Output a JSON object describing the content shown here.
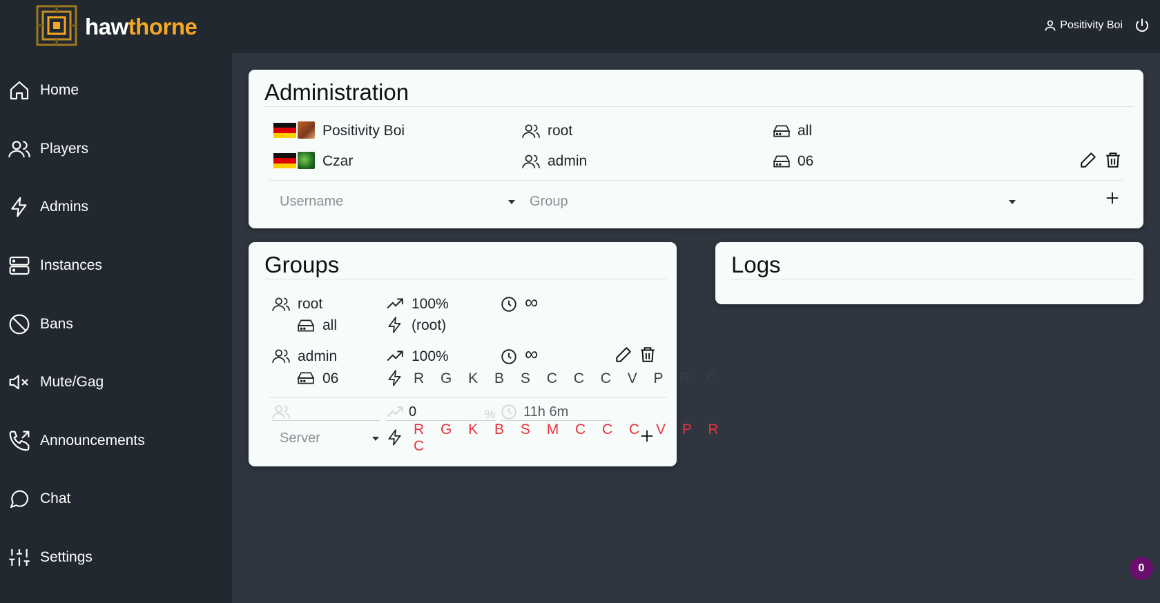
{
  "app": {
    "brand_prefix": "haw",
    "brand_accent": "thorne"
  },
  "header": {
    "user_name": "Positivity Boi"
  },
  "sidebar": {
    "items": [
      {
        "label": "Home",
        "icon": "home-icon"
      },
      {
        "label": "Players",
        "icon": "users-icon"
      },
      {
        "label": "Admins",
        "icon": "bolt-icon"
      },
      {
        "label": "Instances",
        "icon": "server-icon"
      },
      {
        "label": "Bans",
        "icon": "ban-icon"
      },
      {
        "label": "Mute/Gag",
        "icon": "mute-icon"
      },
      {
        "label": "Announcements",
        "icon": "phone-outgoing-icon"
      },
      {
        "label": "Chat",
        "icon": "chat-icon"
      },
      {
        "label": "Settings",
        "icon": "sliders-icon"
      }
    ]
  },
  "administration": {
    "title": "Administration",
    "rows": [
      {
        "name": "Positivity Boi",
        "group": "root",
        "server": "all"
      },
      {
        "name": "Czar",
        "group": "admin",
        "server": "06"
      }
    ],
    "username_placeholder": "Username",
    "group_placeholder": "Group"
  },
  "groups": {
    "title": "Groups",
    "rows": [
      {
        "name": "root",
        "server": "all",
        "immunity": "100%",
        "flags": "(root)",
        "time": "∞"
      },
      {
        "name": "admin",
        "server": "06",
        "immunity": "100%",
        "flags": "R G K B S C C C V P R C",
        "time": "∞"
      }
    ],
    "new_row": {
      "immunity_value": "0",
      "immunity_unit": "%",
      "time_value": "11h 6m",
      "server_placeholder": "Server",
      "flags_line1": "R G K B S M C C C V P R",
      "flags_line2": "C"
    }
  },
  "logs": {
    "title": "Logs"
  },
  "notifications": {
    "count": "0"
  },
  "colors": {
    "accent": "#f5a623",
    "sidebar": "#222830",
    "background": "#2f3640",
    "card": "#f7fbfa",
    "flag_red": "#e8323c",
    "badge": "#6a0f6e"
  }
}
